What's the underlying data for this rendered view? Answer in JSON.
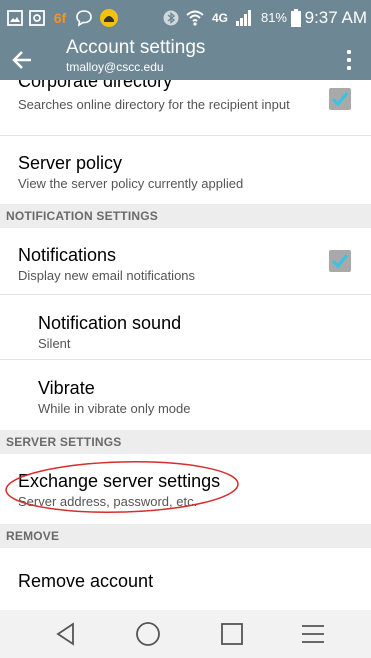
{
  "status_bar": {
    "carrier_logo": "6f",
    "network": "4G",
    "battery_pct": "81%",
    "time": "9:37 AM"
  },
  "app_bar": {
    "title": "Account settings",
    "subtitle": "tmalloy@cscc.edu"
  },
  "settings": {
    "corporate_directory": {
      "title": "Corporate directory",
      "subtitle": "Searches online directory for the recipient input",
      "checked": true
    },
    "server_policy": {
      "title": "Server policy",
      "subtitle": "View the server policy currently applied"
    },
    "notification_header": "NOTIFICATION SETTINGS",
    "notifications": {
      "title": "Notifications",
      "subtitle": "Display new email notifications",
      "checked": true
    },
    "notification_sound": {
      "title": "Notification sound",
      "subtitle": "Silent"
    },
    "vibrate": {
      "title": "Vibrate",
      "subtitle": "While in vibrate only mode"
    },
    "server_header": "SERVER SETTINGS",
    "exchange": {
      "title": "Exchange server settings",
      "subtitle": "Server address, password, etc."
    },
    "remove_header": "REMOVE",
    "remove_account": {
      "title": "Remove account"
    }
  },
  "colors": {
    "app_bar": "#6e8794",
    "check_accent": "#33c4e8",
    "annotation": "#d62d2d"
  }
}
